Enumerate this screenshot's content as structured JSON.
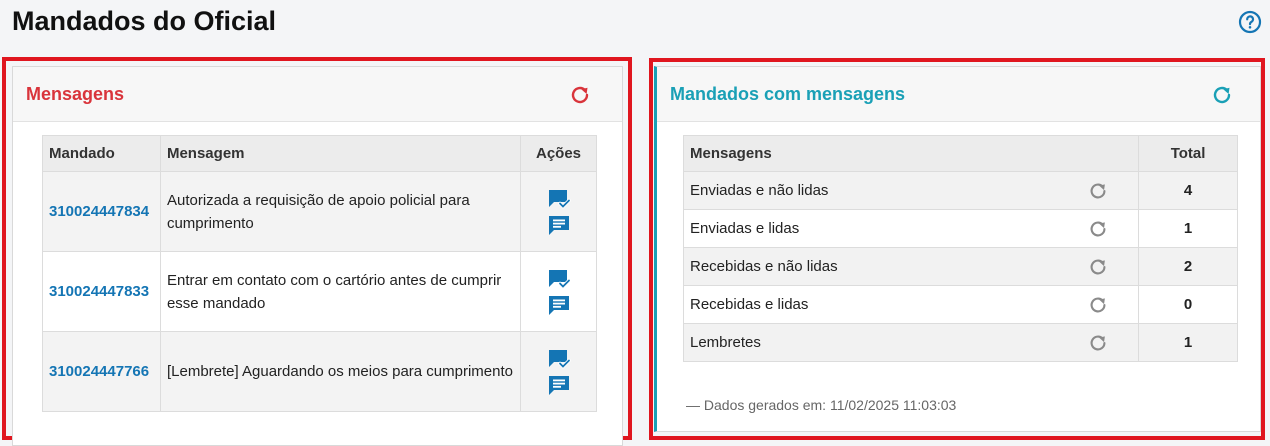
{
  "page": {
    "title": "Mandados do Oficial"
  },
  "colors": {
    "accent_red": "#d9343b",
    "accent_teal": "#1aa0b6",
    "link_blue": "#1475b4",
    "outline_red": "#e0161f"
  },
  "messages_panel": {
    "title": "Mensagens",
    "columns": {
      "mandado": "Mandado",
      "mensagem": "Mensagem",
      "acoes": "Ações"
    },
    "rows": [
      {
        "mandado": "310024447834",
        "mensagem": "Autorizada a requisição de apoio policial para cumprimento"
      },
      {
        "mandado": "310024447833",
        "mensagem": "Entrar em contato com o cartório antes de cumprir esse mandado"
      },
      {
        "mandado": "310024447766",
        "mensagem": "[Lembrete] Aguardando os meios para cumprimento"
      }
    ],
    "icons": {
      "refresh": "refresh-icon",
      "mark_read": "mark-read-icon",
      "open_message": "message-icon"
    }
  },
  "summary_panel": {
    "title": "Mandados com mensagens",
    "columns": {
      "mensagens": "Mensagens",
      "total": "Total"
    },
    "rows": [
      {
        "label": "Enviadas e não lidas",
        "total": "4"
      },
      {
        "label": "Enviadas e lidas",
        "total": "1"
      },
      {
        "label": "Recebidas e não lidas",
        "total": "2"
      },
      {
        "label": "Recebidas e lidas",
        "total": "0"
      },
      {
        "label": "Lembretes",
        "total": "1"
      }
    ],
    "footnote": "— Dados gerados em: 11/02/2025 11:03:03"
  }
}
